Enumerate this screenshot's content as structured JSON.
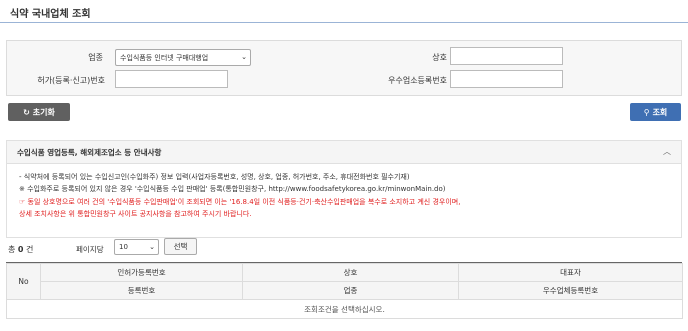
{
  "page": {
    "title": "식약 국내업체 조회"
  },
  "search": {
    "business_label": "업종",
    "business_value": "수입식품등 인터넷 구매대행업",
    "company_label": "상호",
    "company_value": "",
    "license_label": "허가(등록·신고)번호",
    "license_value": "",
    "excellent_label": "우수업소등록번호",
    "excellent_value": ""
  },
  "buttons": {
    "reset": "초기화",
    "search": "조회",
    "select": "선택"
  },
  "notice": {
    "title": "수입식품 영업등록, 해외제조업소 등 안내사항",
    "lines": [
      "- 식약처에 등록되어 있는 수입신고인(수입화주) 정보 입력(사업자등록번호, 성명, 상호, 업종, 허가번호, 주소, 휴대전화번호 필수기재)",
      "  ※ 수입화주로 등록되어 있지 않은 경우 '수입식품등 수입 판매업' 등록(통합민원창구, http://www.foodsafetykorea.go.kr/minwonMain.do)",
      "☞ 동일 상호명으로 여러 건의 '수입식품등 수입판매업'이 조회되면 이는 '16.8.4일 이전 식품등·건기·축산수입판매업을 복수로 소지하고 계신 경우이며,",
      "   상세 조치사항은 위 통합민원창구 사이트 공지사항을 참고하여 주시기 바랍니다."
    ]
  },
  "result": {
    "total_prefix": "총",
    "total_count": "0",
    "total_suffix": "건",
    "per_page_label": "페이지당",
    "per_page_value": "10"
  },
  "table": {
    "no_header": "No",
    "headers_top": [
      "인허가등록번호",
      "상호",
      "대표자"
    ],
    "headers_bottom": [
      "등록번호",
      "업종",
      "우수업체등록번호"
    ],
    "empty_message": "조회조건을 선택하십시오."
  }
}
